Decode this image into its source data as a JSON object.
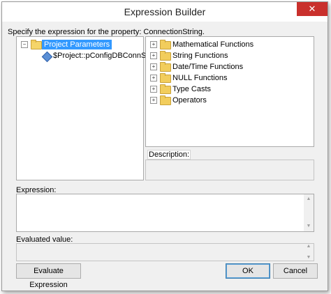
{
  "window": {
    "title": "Expression Builder",
    "close_label": "✕"
  },
  "prompt": "Specify the expression for the property: ConnectionString.",
  "left_tree": {
    "root_label": "Project Parameters",
    "expander": "−",
    "child_label": "$Project::pConfigDBConnStr"
  },
  "right_tree": {
    "items": [
      {
        "label": "Mathematical Functions"
      },
      {
        "label": "String Functions"
      },
      {
        "label": "Date/Time Functions"
      },
      {
        "label": "NULL Functions"
      },
      {
        "label": "Type Casts"
      },
      {
        "label": "Operators"
      }
    ],
    "expander": "+"
  },
  "description": {
    "label": "Description:",
    "value": ""
  },
  "expression": {
    "label": "Expression:",
    "value": ""
  },
  "evaluated": {
    "label": "Evaluated value:",
    "value": ""
  },
  "buttons": {
    "evaluate": "Evaluate Expression",
    "ok": "OK",
    "cancel": "Cancel"
  },
  "colors": {
    "selection": "#3399ff",
    "close": "#c9302c",
    "folder": "#f2cd5c"
  }
}
